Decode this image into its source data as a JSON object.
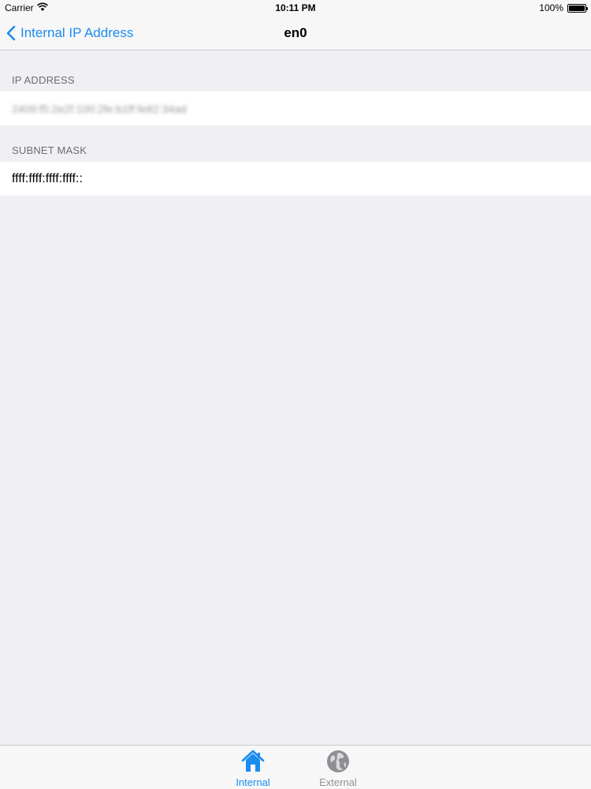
{
  "status_bar": {
    "carrier": "Carrier",
    "time": "10:11 PM",
    "battery": "100%"
  },
  "nav": {
    "back_label": "Internal IP Address",
    "title": "en0"
  },
  "sections": [
    {
      "header": "IP ADDRESS",
      "value": "2409:f5:2e2f:100:2fe:b1ff:fe82:34ad"
    },
    {
      "header": "SUBNET MASK",
      "value": "ffff:ffff:ffff:ffff::"
    }
  ],
  "tabs": [
    {
      "label": "Internal",
      "icon": "house-icon",
      "active": true
    },
    {
      "label": "External",
      "icon": "globe-icon",
      "active": false
    }
  ],
  "colors": {
    "accent": "#1a8cf0",
    "background": "#efeff4",
    "inactive": "#929292"
  }
}
